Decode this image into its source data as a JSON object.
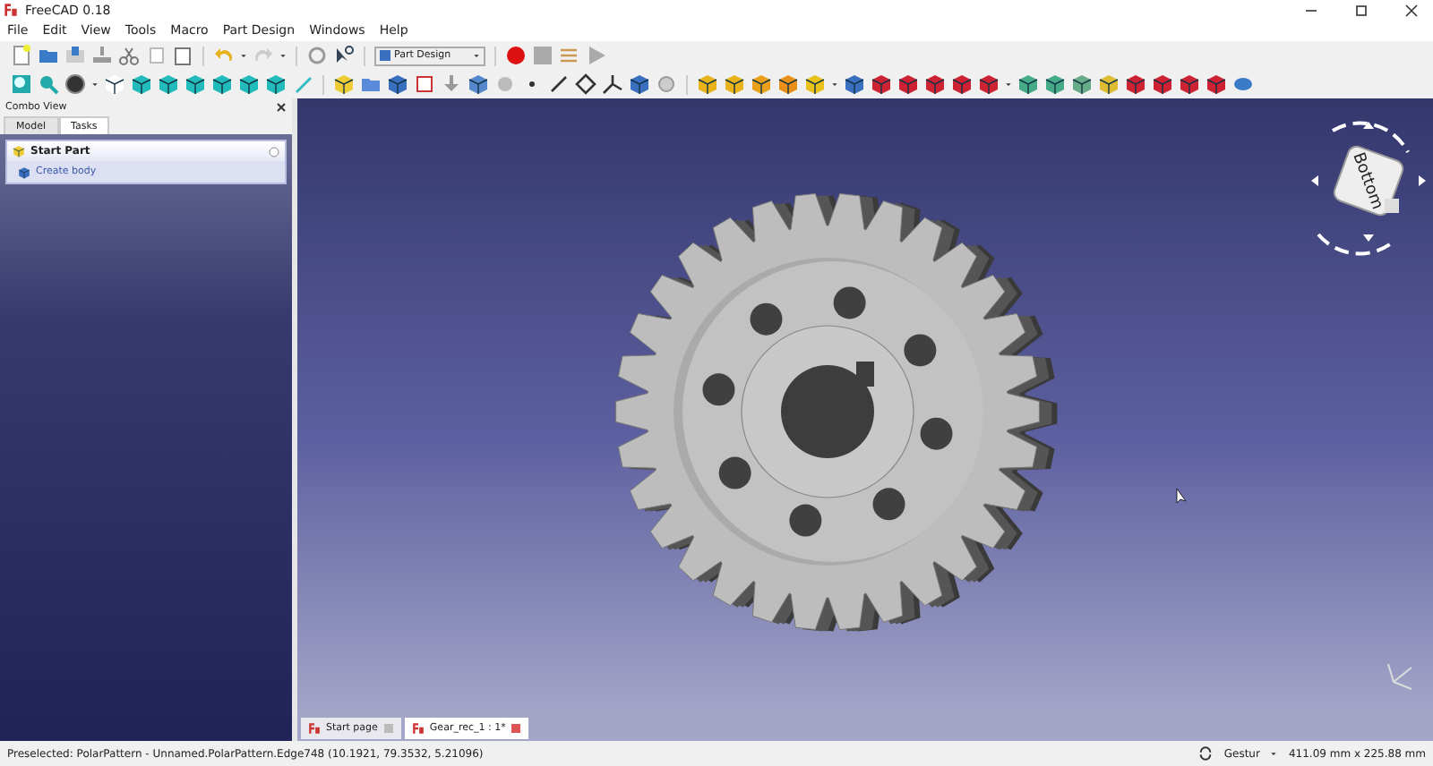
{
  "window": {
    "title": "FreeCAD 0.18"
  },
  "menu": [
    "File",
    "Edit",
    "View",
    "Tools",
    "Macro",
    "Part Design",
    "Windows",
    "Help"
  ],
  "workbench_selector": {
    "value": "Part Design"
  },
  "combo_view": {
    "title": "Combo View",
    "tabs": [
      {
        "label": "Model",
        "selected": false
      },
      {
        "label": "Tasks",
        "selected": true
      }
    ],
    "task_panel": {
      "title": "Start Part",
      "items": [
        "Create body"
      ]
    }
  },
  "nav_cube": {
    "face_label": "Bottom"
  },
  "document_tabs": [
    {
      "label": "Start page",
      "selected": false
    },
    {
      "label": "Gear_rec_1 : 1*",
      "selected": true
    }
  ],
  "status_bar": {
    "message": "Preselected: PolarPattern - Unnamed.PolarPattern.Edge748 (10.1921, 79.3532, 5.21096)",
    "navigation_style": "Gestur",
    "dimensions": "411.09 mm x 225.88 mm"
  }
}
